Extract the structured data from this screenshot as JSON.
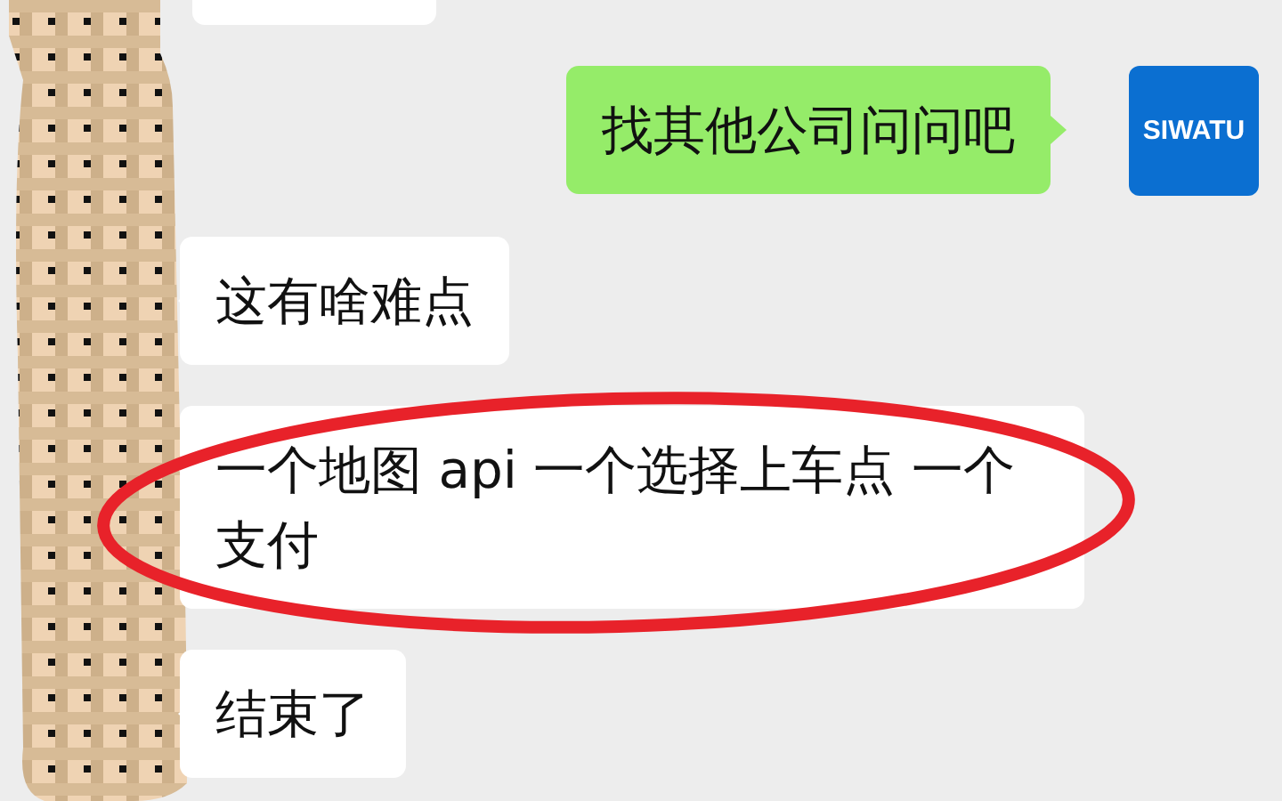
{
  "chat": {
    "messages": [
      {
        "kind": "clipped"
      },
      {
        "kind": "sent",
        "text": "找其他公司问问吧",
        "avatar_text": "SIWATU"
      },
      {
        "kind": "received",
        "text": "这有啥难点",
        "highlighted": false
      },
      {
        "kind": "received",
        "text": "一个地图 api 一个选择上车点 一个支付",
        "highlighted": true
      },
      {
        "kind": "received",
        "text": "结束了",
        "highlighted": false
      }
    ]
  }
}
